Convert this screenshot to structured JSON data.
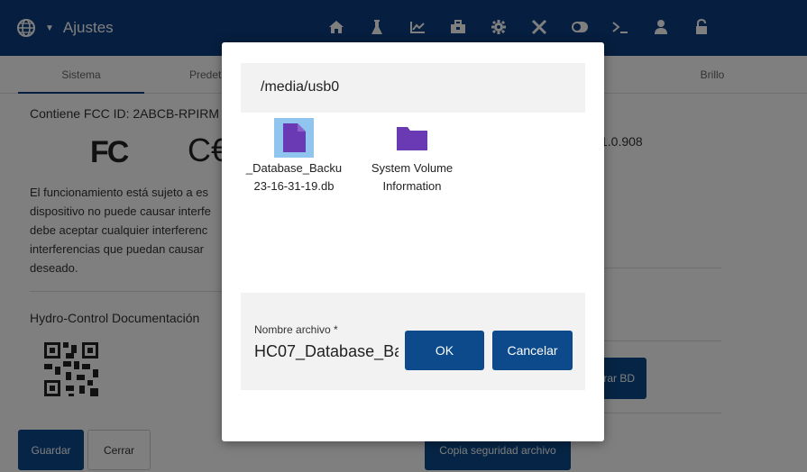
{
  "header": {
    "title": "Ajustes",
    "globe_icon": "globe-icon",
    "caret_icon": "caret-down-icon",
    "nav_icons": [
      "home-icon",
      "flask-icon",
      "chart-icon",
      "toolbox-icon",
      "gear-icon",
      "tools-icon",
      "toggle-icon",
      "terminal-icon",
      "user-icon",
      "unlock-icon"
    ],
    "bg_color": "#0c3d7e"
  },
  "tabs": [
    {
      "label": "Sistema",
      "active": true
    },
    {
      "label": "Predet",
      "active": false
    },
    {
      "label": "Brillo",
      "active": false
    }
  ],
  "main": {
    "fcc_id": "Contiene FCC ID: 2ABCB-RPIRM",
    "fc_logo": "FC",
    "ce_logo": "C€",
    "notice_lines": [
      "El funcionamiento está sujeto a es",
      "dispositivo no puede causar interfe",
      "debe aceptar cualquier interferenc",
      "interferencias que puedan causar",
      "deseado."
    ],
    "doc_title": "Hydro-Control Documentación",
    "version": "1.0.908",
    "restore_db_label": "rar BD",
    "backup_file_label": "Copia seguridad archivo",
    "save_label": "Guardar",
    "close_label": "Cerrar"
  },
  "dialog": {
    "path": "/media/usb0",
    "files": [
      {
        "name_line1": "_Database_Backu",
        "name_line2": "23-16-31-19.db",
        "icon": "file-icon",
        "selected": true
      },
      {
        "name_line1": "System Volume",
        "name_line2": "Information",
        "icon": "folder-icon",
        "selected": false
      }
    ],
    "filename_label": "Nombre archivo *",
    "filename_value": "HC07_Database_Ba",
    "ok_label": "OK",
    "cancel_label": "Cancelar",
    "icon_color": "#6a3ab5",
    "selected_color": "#8fc5ee"
  }
}
